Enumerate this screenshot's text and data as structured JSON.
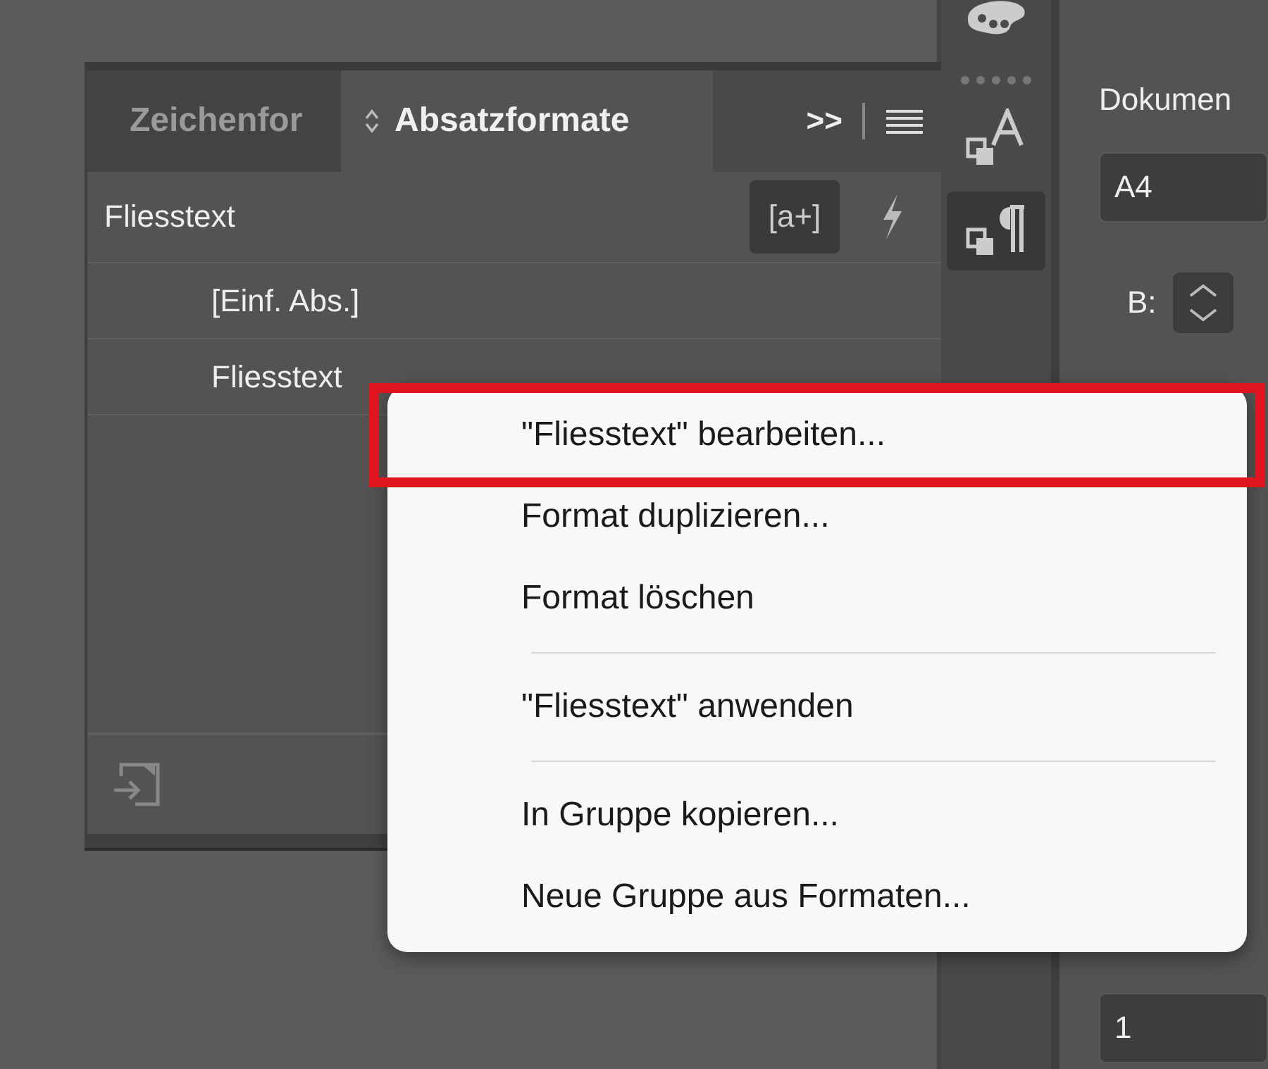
{
  "panel": {
    "tabs": [
      {
        "label": "Zeichenfor",
        "selected": false
      },
      {
        "label": "Absatzformate",
        "selected": true
      }
    ],
    "overflow": ">>",
    "current_style": "Fliesstext",
    "new_style_button": "[a+]",
    "styles": [
      {
        "label": "[Einf. Abs.]"
      },
      {
        "label": "Fliesstext"
      }
    ]
  },
  "toolbar": [
    {
      "kind": "palette",
      "selected": false
    },
    {
      "kind": "character",
      "selected": false
    },
    {
      "kind": "paragraph",
      "selected": true
    }
  ],
  "properties": {
    "heading": "Dokumen",
    "size_field": "A4",
    "width_label": "B:",
    "page_field": "1"
  },
  "context_menu": [
    {
      "kind": "item",
      "label": "\"Fliesstext\" bearbeiten...",
      "highlighted": true
    },
    {
      "kind": "item",
      "label": "Format duplizieren...",
      "highlighted": false
    },
    {
      "kind": "item",
      "label": "Format löschen",
      "highlighted": false
    },
    {
      "kind": "separator"
    },
    {
      "kind": "item",
      "label": "\"Fliesstext\" anwenden",
      "highlighted": false
    },
    {
      "kind": "separator"
    },
    {
      "kind": "item",
      "label": "In Gruppe kopieren...",
      "highlighted": false
    },
    {
      "kind": "item",
      "label": "Neue Gruppe aus Formaten...",
      "highlighted": false
    }
  ]
}
